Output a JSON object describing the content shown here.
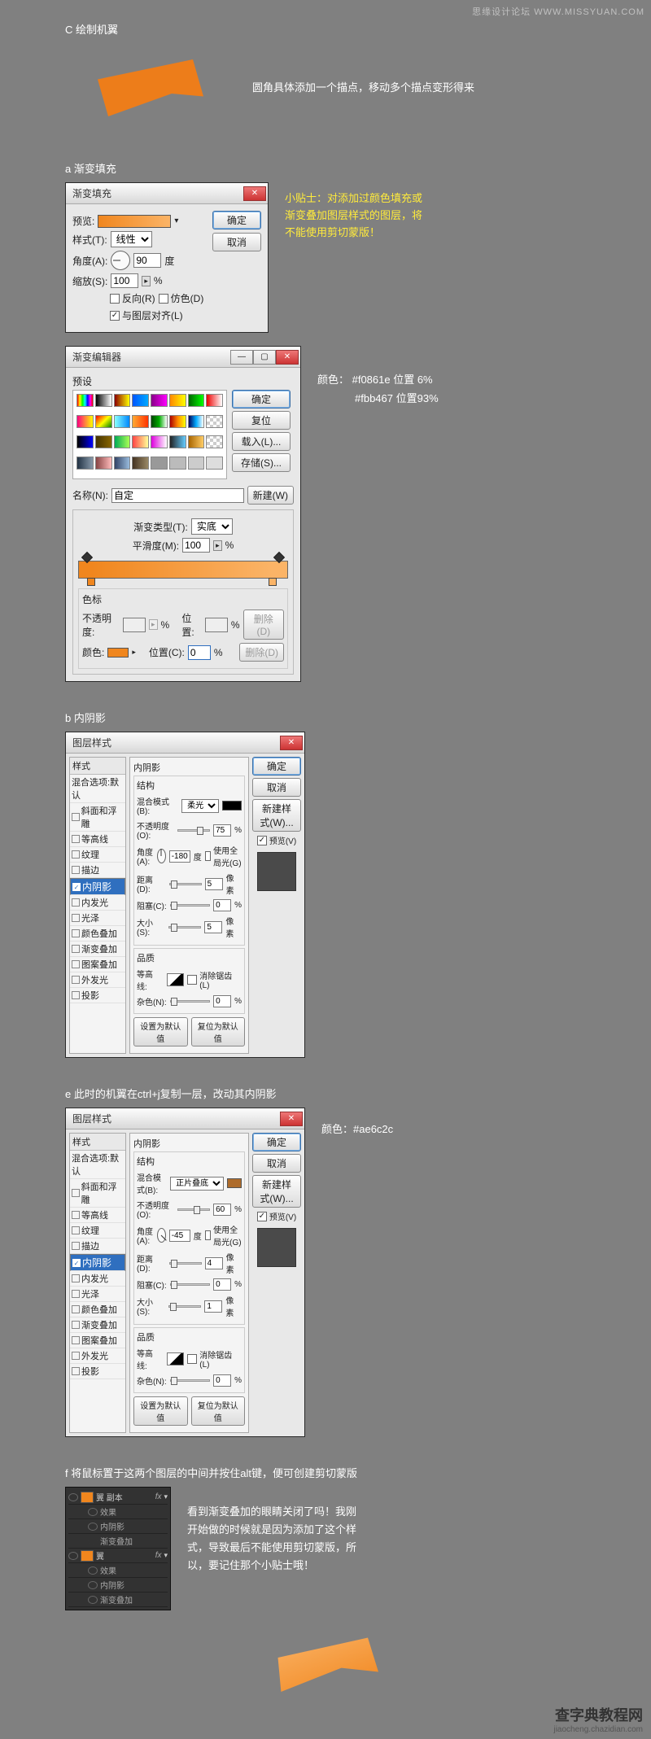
{
  "watermarks": {
    "top": "思缘设计论坛 WWW.MISSYUAN.COM",
    "bottom_big": "查字典教程网",
    "bottom_small": "jiaocheng.chazidian.com"
  },
  "headings": {
    "c": "C 绘制机翼",
    "a": "a 渐变填充",
    "b": "b 内阴影",
    "e": "e 此时的机翼在ctrl+j复制一层，改动其内阴影",
    "f": "f 将鼠标置于这两个图层的中间并按住alt键，便可创建剪切蒙版"
  },
  "paragraphs": {
    "c_note": "圆角具体添加一个描点，移动多个描点变形得来",
    "a_tip": "小贴士：对添加过颜色填充或渐变叠加图层样式的图层，将不能使用剪切蒙版！",
    "grad_color_note_l1": "颜色：  #f0861e   位置 6%",
    "grad_color_note_l2": "#fbb467   位置93%",
    "e_color_note": "颜色：#ae6c2c",
    "f_note": "看到渐变叠加的眼睛关闭了吗！我刚开始做的时候就是因为添加了这个样式，导致最后不能使用剪切蒙版，所以，要记住那个小贴士哦！"
  },
  "gradient_fill_dialog": {
    "title": "渐变填充",
    "preview_label": "预览:",
    "style_label": "样式(T):",
    "style_value": "线性",
    "angle_label": "角度(A):",
    "angle_value": "90",
    "angle_unit": "度",
    "scale_label": "缩放(S):",
    "scale_value": "100",
    "scale_unit": "%",
    "reverse": "反向(R)",
    "dither": "仿色(D)",
    "align": "与图层对齐(L)",
    "ok": "确定",
    "cancel": "取消"
  },
  "gradient_editor": {
    "title": "渐变编辑器",
    "presets_label": "预设",
    "name_label": "名称(N):",
    "name_value": "自定",
    "new_btn": "新建(W)",
    "type_label": "渐变类型(T):",
    "type_value": "实底",
    "smooth_label": "平滑度(M):",
    "smooth_value": "100",
    "smooth_unit": "%",
    "stops_label": "色标",
    "opacity_label": "不透明度:",
    "opacity_unit": "%",
    "pos_label": "位置:",
    "pos_unit": "%",
    "delete_btn": "删除(D)",
    "color_label": "颜色:",
    "pos2_label": "位置(C):",
    "pos2_value": "0",
    "ok": "确定",
    "reset": "复位",
    "load": "载入(L)...",
    "save": "存储(S)..."
  },
  "layer_style_common": {
    "title": "图层样式",
    "left_header": "样式",
    "items": {
      "blend_default": "混合选项:默认",
      "bevel": "斜面和浮雕",
      "contour": "等高线",
      "texture": "纹理",
      "stroke": "描边",
      "inner_shadow": "内阴影",
      "inner_glow": "内发光",
      "satin": "光泽",
      "color_overlay": "颜色叠加",
      "gradient_overlay": "渐变叠加",
      "pattern_overlay": "图案叠加",
      "outer_glow": "外发光",
      "drop_shadow": "投影"
    },
    "right": {
      "ok": "确定",
      "cancel": "取消",
      "new_style": "新建样式(W)...",
      "preview": "预览(V)"
    },
    "center": {
      "panel_title": "内阴影",
      "group_structure": "结构",
      "blend_mode_label": "混合模式(B):",
      "opacity_label": "不透明度(O):",
      "opacity_unit": "%",
      "angle_label": "角度(A):",
      "angle_unit": "度",
      "global_light": "使用全局光(G)",
      "distance_label": "距离(D):",
      "distance_unit": "像素",
      "choke_label": "阻塞(C):",
      "choke_unit": "%",
      "size_label": "大小(S):",
      "size_unit": "像素",
      "group_quality": "品质",
      "contour_label": "等高线:",
      "anti_alias": "消除锯齿(L)",
      "noise_label": "杂色(N):",
      "noise_unit": "%",
      "make_default": "设置为默认值",
      "reset_default": "复位为默认值"
    }
  },
  "layer_style_b": {
    "blend_mode_value": "柔光",
    "opacity_value": "75",
    "angle_value": "-180",
    "distance_value": "5",
    "choke_value": "0",
    "size_value": "5",
    "noise_value": "0",
    "color_hex": "#000000"
  },
  "layer_style_e": {
    "blend_mode_value": "正片叠底",
    "opacity_value": "60",
    "angle_value": "-45",
    "distance_value": "4",
    "choke_value": "0",
    "size_value": "1",
    "noise_value": "0",
    "color_hex": "#ae6c2c"
  },
  "layers_panel": {
    "row1": "翼 副本",
    "row1_fx": "fx",
    "row1_effects": "效果",
    "row1_is": "内阴影",
    "row1_go": "渐变叠加",
    "row2": "翼",
    "row2_fx": "fx",
    "row2_effects": "效果",
    "row2_is": "内阴影",
    "row2_go": "渐变叠加"
  },
  "chart_data": {
    "type": "table",
    "title": "渐变填充色标",
    "columns": [
      "颜色",
      "位置"
    ],
    "rows": [
      [
        "#f0861e",
        "6%"
      ],
      [
        "#fbb467",
        "93%"
      ]
    ]
  }
}
